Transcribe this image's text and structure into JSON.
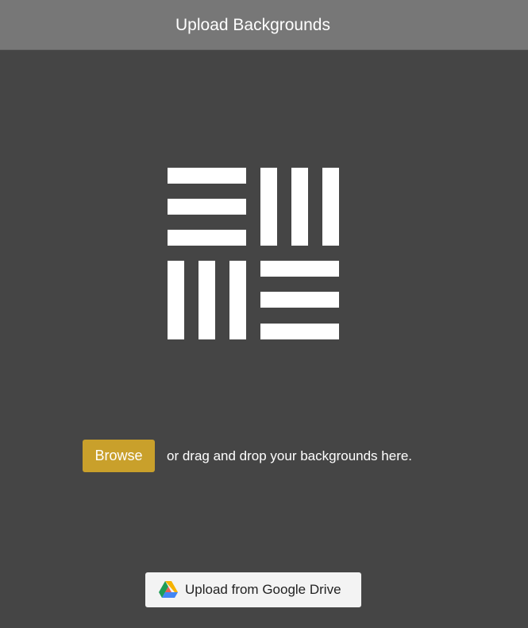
{
  "header": {
    "title": "Upload Backgrounds"
  },
  "logo": {
    "icon": "basketweave-logo-icon",
    "color": "#ffffff"
  },
  "drop_zone": {
    "browse_label": "Browse",
    "instructions": "or drag and drop your backgrounds here.",
    "browse_color": "#c9a02b"
  },
  "google_drive": {
    "label": "Upload from Google Drive",
    "icon": "google-drive-icon"
  },
  "colors": {
    "background": "#454545",
    "header": "#777777"
  }
}
